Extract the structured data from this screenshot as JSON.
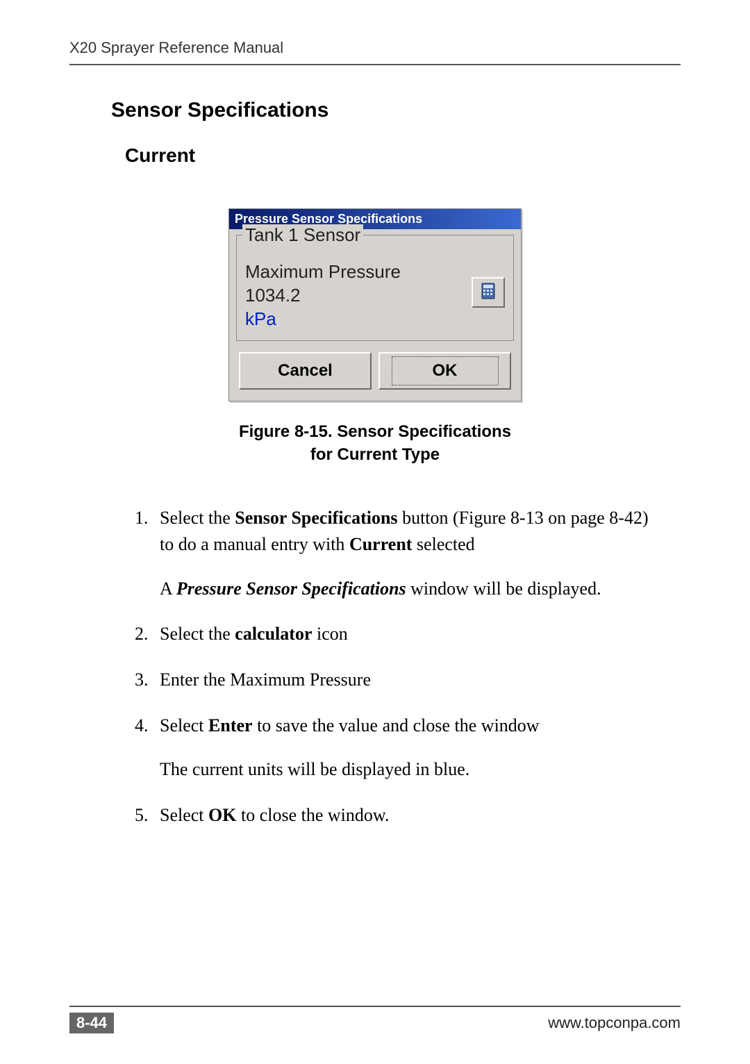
{
  "header": {
    "running_head": "X20 Sprayer Reference Manual"
  },
  "section": {
    "title": "Sensor Specifications",
    "subtitle": "Current"
  },
  "dialog": {
    "title": "Pressure Sensor Specifications",
    "group_legend": "Tank 1 Sensor",
    "field_label": "Maximum Pressure",
    "field_value": "1034.2",
    "unit": "kPa",
    "calc_icon": "calculator-icon",
    "cancel_label": "Cancel",
    "ok_label": "OK"
  },
  "caption": {
    "line1": "Figure 8-15. Sensor Specifications",
    "line2": "for Current Type"
  },
  "steps": {
    "s1_a": "Select the ",
    "s1_b": "Sensor Specifications",
    "s1_c": " button (Figure 8-13 on page 8-42) to do a manual entry with ",
    "s1_d": "Current",
    "s1_e": " selected",
    "s1_sub_a": "A ",
    "s1_sub_b": "Pressure Sensor Specifications",
    "s1_sub_c": " window will be displayed.",
    "s2_a": "Select the ",
    "s2_b": "calculator",
    "s2_c": " icon",
    "s3": "Enter the Maximum Pressure",
    "s4_a": "Select ",
    "s4_b": "Enter",
    "s4_c": " to save the value and close the window",
    "s4_sub": "The current units will be displayed in blue.",
    "s5_a": "Select ",
    "s5_b": "OK",
    "s5_c": " to close the window."
  },
  "footer": {
    "page_num": "8-44",
    "url": "www.topconpa.com"
  }
}
